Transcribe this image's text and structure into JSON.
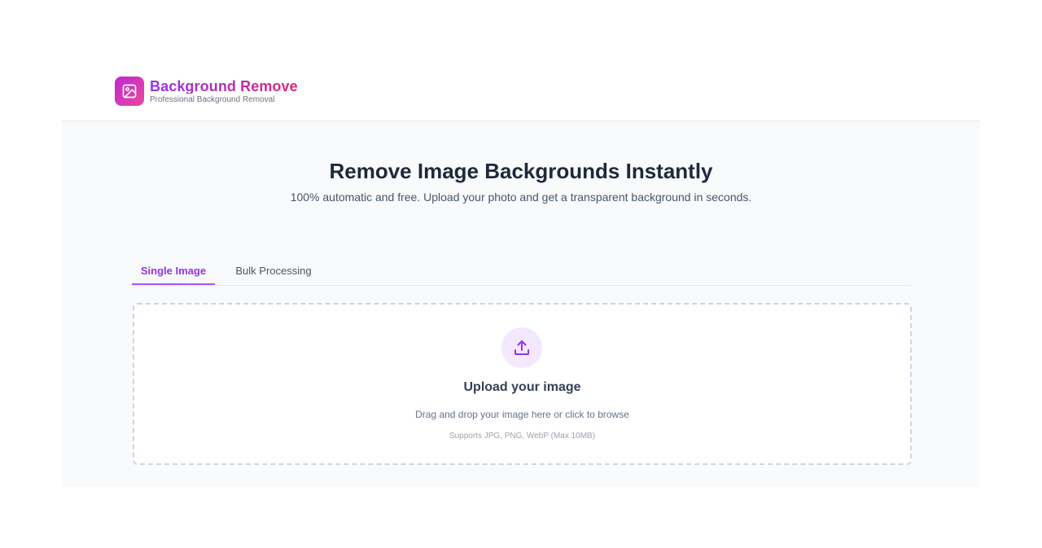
{
  "header": {
    "brand_name": "Background Remove",
    "brand_tagline": "Professional Background Removal",
    "logo_icon": "image-icon"
  },
  "hero": {
    "title": "Remove Image Backgrounds Instantly",
    "subtitle": "100% automatic and free. Upload your photo and get a transparent background in seconds."
  },
  "tabs": [
    {
      "label": "Single Image",
      "active": true
    },
    {
      "label": "Bulk Processing",
      "active": false
    }
  ],
  "upload": {
    "icon": "upload-icon",
    "title": "Upload your image",
    "instruction": "Drag and drop your image here or click to browse",
    "formats": "Supports JPG, PNG, WebP (Max 10MB)"
  },
  "colors": {
    "accent": "#9333ea",
    "accent_light": "#f3e8ff",
    "brand_gradient_start": "#c026d3",
    "brand_gradient_end": "#ec4899",
    "page_bg": "#f8fafc"
  }
}
